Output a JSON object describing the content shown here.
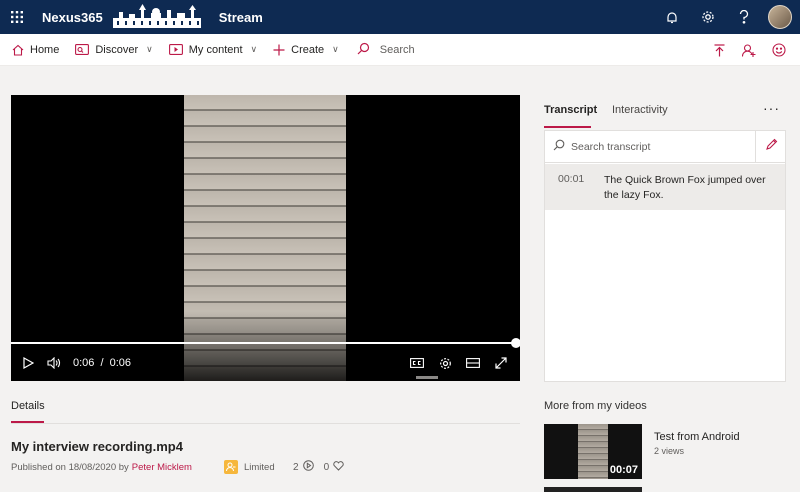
{
  "header": {
    "org": "Nexus365",
    "product": "Stream",
    "icons": [
      "waffle-icon",
      "bell-icon",
      "gear-icon",
      "help-icon",
      "avatar"
    ]
  },
  "nav": {
    "home": "Home",
    "discover": "Discover",
    "my_content": "My content",
    "create": "Create",
    "search_placeholder": "Search"
  },
  "player": {
    "current_time": "0:06",
    "separator": "/",
    "duration": "0:06",
    "progress": 1.0
  },
  "details": {
    "tab_label": "Details",
    "title": "My interview recording.mp4",
    "published_prefix": "Published on 18/08/2020 by",
    "author": "Peter Micklem",
    "permission": "Limited",
    "views": "2",
    "likes": "0"
  },
  "panel": {
    "tab_transcript": "Transcript",
    "tab_interactivity": "Interactivity",
    "more": "···",
    "search_placeholder": "Search transcript",
    "lines": [
      {
        "time": "00:01",
        "text": "The Quick Brown Fox jumped over the lazy Fox."
      }
    ]
  },
  "more_videos": {
    "heading": "More from my videos",
    "items": [
      {
        "title": "Test from Android",
        "views": "2 views",
        "duration": "00:07"
      }
    ]
  },
  "colors": {
    "header_bg": "#0e2a52",
    "accent": "#bc1948",
    "limited_badge": "#f6b73c"
  }
}
